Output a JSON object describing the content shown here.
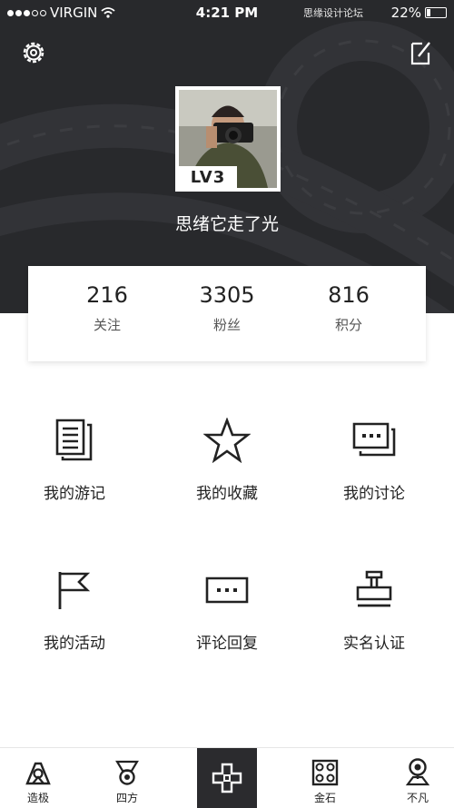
{
  "status_bar": {
    "carrier": "VIRGIN",
    "time": "4:21 PM",
    "watermark": "思缘设计论坛",
    "battery": "22%"
  },
  "profile": {
    "level": "LV3",
    "username": "思绪它走了光"
  },
  "stats": [
    {
      "value": "216",
      "label": "关注"
    },
    {
      "value": "3305",
      "label": "粉丝"
    },
    {
      "value": "816",
      "label": "积分"
    }
  ],
  "menu": [
    {
      "label": "我的游记",
      "icon": "document-icon"
    },
    {
      "label": "我的收藏",
      "icon": "star-icon"
    },
    {
      "label": "我的讨论",
      "icon": "chat-icon"
    },
    {
      "label": "我的活动",
      "icon": "flag-icon"
    },
    {
      "label": "评论回复",
      "icon": "comment-icon"
    },
    {
      "label": "实名认证",
      "icon": "stamp-icon"
    }
  ],
  "tabs": [
    {
      "label": "造极",
      "icon": "peak-icon"
    },
    {
      "label": "四方",
      "icon": "badge-icon"
    },
    {
      "label": "",
      "icon": "cross-icon"
    },
    {
      "label": "金石",
      "icon": "grid-icon"
    },
    {
      "label": "不凡",
      "icon": "pin-icon"
    }
  ]
}
